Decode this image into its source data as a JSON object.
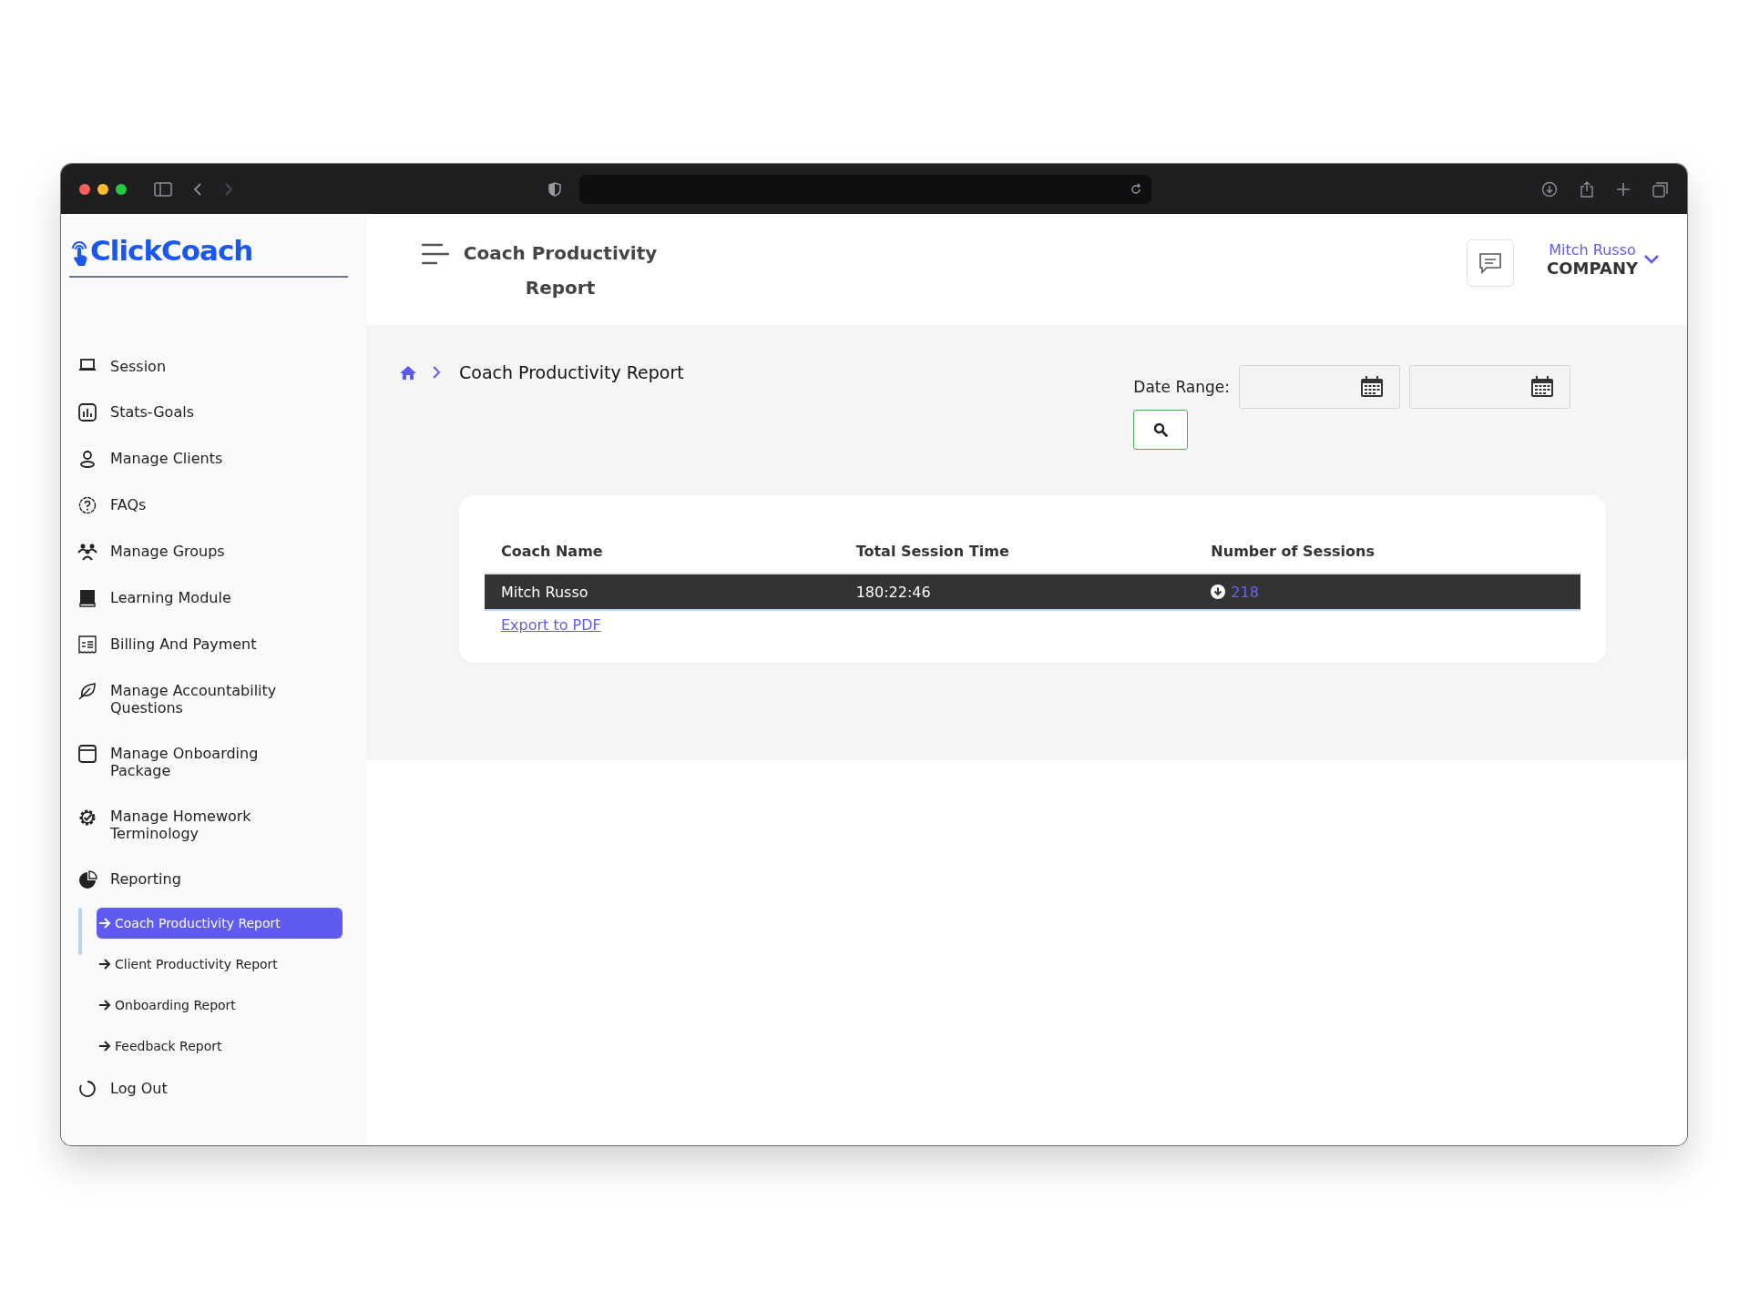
{
  "sidebar": {
    "logo": "ClickCoach",
    "items": [
      {
        "label": "Session"
      },
      {
        "label": "Stats-Goals"
      },
      {
        "label": "Manage Clients"
      },
      {
        "label": "FAQs"
      },
      {
        "label": "Manage Groups"
      },
      {
        "label": "Learning Module"
      },
      {
        "label": "Billing And Payment"
      },
      {
        "label": "Manage Accountability Questions"
      },
      {
        "label": "Manage Onboarding Package"
      },
      {
        "label": "Manage Homework Terminology"
      },
      {
        "label": "Reporting",
        "children": [
          {
            "label": "Coach Productivity Report",
            "selected": true
          },
          {
            "label": "Client Productivity Report",
            "selected": false
          },
          {
            "label": "Onboarding Report",
            "selected": false
          },
          {
            "label": "Feedback Report",
            "selected": false
          }
        ]
      },
      {
        "label": "Log Out"
      }
    ]
  },
  "header": {
    "title": "Coach Productivity Report",
    "user": {
      "name": "Mitch Russo",
      "company": "COMPANY"
    }
  },
  "breadcrumb": {
    "current": "Coach Productivity Report"
  },
  "filter": {
    "label": "Date Range:"
  },
  "table": {
    "columns": [
      "Coach Name",
      "Total Session Time",
      "Number of Sessions"
    ],
    "rows": [
      {
        "coach": "Mitch Russo",
        "time": "180:22:46",
        "sessions": "218",
        "selected": true
      }
    ]
  },
  "export_link": "Export to PDF"
}
